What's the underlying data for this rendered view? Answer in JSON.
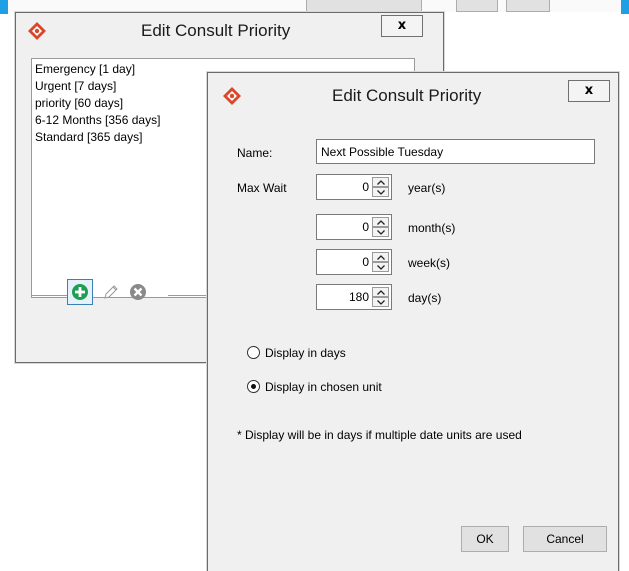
{
  "background": {
    "accent_color": "#1e9fe6"
  },
  "back_dialog": {
    "title": "Edit Consult Priority",
    "close_label": "x",
    "priorities": [
      "Emergency [1 day]",
      "Urgent [7 days]",
      "priority [60 days]",
      "6-12 Months [356 days]",
      "Standard [365 days]"
    ],
    "toolbar_icons": [
      "add-icon",
      "edit-pencil-icon",
      "delete-icon"
    ]
  },
  "front_dialog": {
    "title": "Edit Consult Priority",
    "close_label": "x",
    "name_label": "Name:",
    "name_value": "Next Possible Tuesday",
    "max_wait_label": "Max Wait",
    "units": [
      {
        "value": "0",
        "label": "year(s)"
      },
      {
        "value": "0",
        "label": "month(s)"
      },
      {
        "value": "0",
        "label": "week(s)"
      },
      {
        "value": "180",
        "label": "day(s)"
      }
    ],
    "display_options": [
      {
        "label": "Display in days",
        "selected": false
      },
      {
        "label": "Display in chosen unit",
        "selected": true
      }
    ],
    "note": "* Display will be in days if multiple date units are used",
    "ok_label": "OK",
    "cancel_label": "Cancel"
  },
  "colors": {
    "icon_red": "#d9472b",
    "add_green": "#1e9e52",
    "delete_gray": "#8a8a8a",
    "dialog_bg": "#f0f0f0"
  }
}
